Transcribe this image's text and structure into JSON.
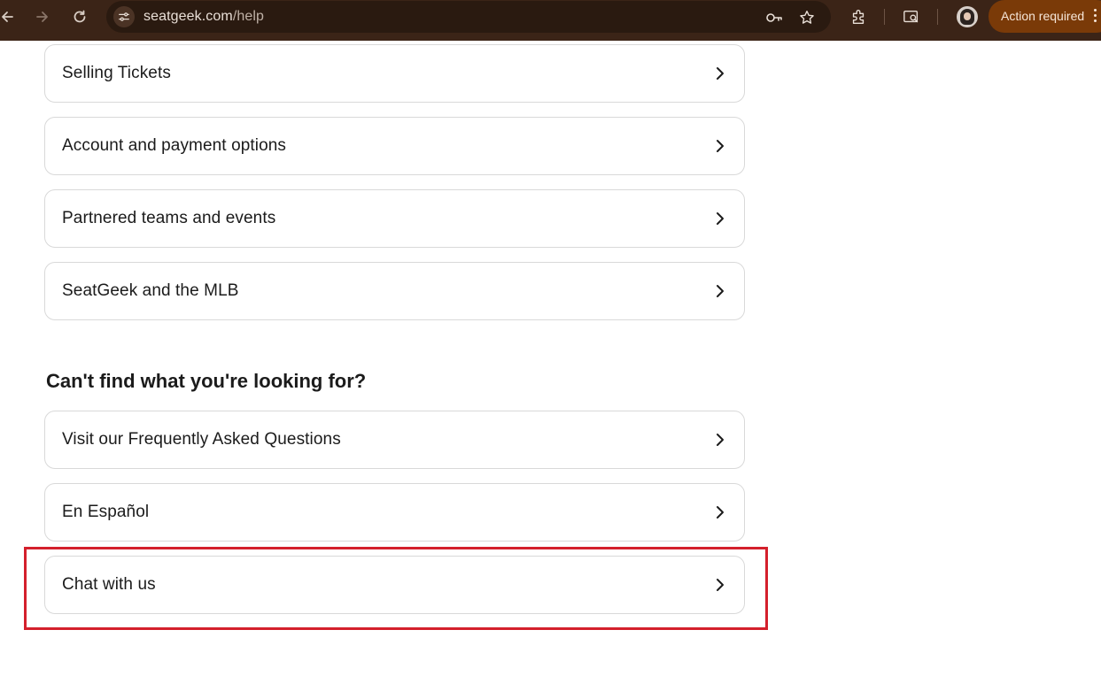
{
  "browser": {
    "url_host": "seatgeek.com",
    "url_path": "/help",
    "action_pill_label": "Action required",
    "icons": [
      "back-icon",
      "forward-icon",
      "reload-icon",
      "site-info-icon",
      "password-key-icon",
      "bookmark-star-icon",
      "extensions-icon",
      "tab-search-icon",
      "profile-avatar",
      "more-menu-icon"
    ]
  },
  "topics": [
    {
      "label": "Selling Tickets"
    },
    {
      "label": "Account and payment options"
    },
    {
      "label": "Partnered teams and events"
    },
    {
      "label": "SeatGeek and the MLB"
    }
  ],
  "help_section": {
    "heading": "Can't find what you're looking for?",
    "items": [
      {
        "label": "Visit our Frequently Asked Questions"
      },
      {
        "label": "En Español"
      },
      {
        "label": "Chat with us"
      }
    ]
  },
  "colors": {
    "toolbar_bg": "#3b2417",
    "action_pill_bg": "#7a3a08",
    "highlight_border": "#d4202c",
    "card_border": "#d9d9d9"
  }
}
